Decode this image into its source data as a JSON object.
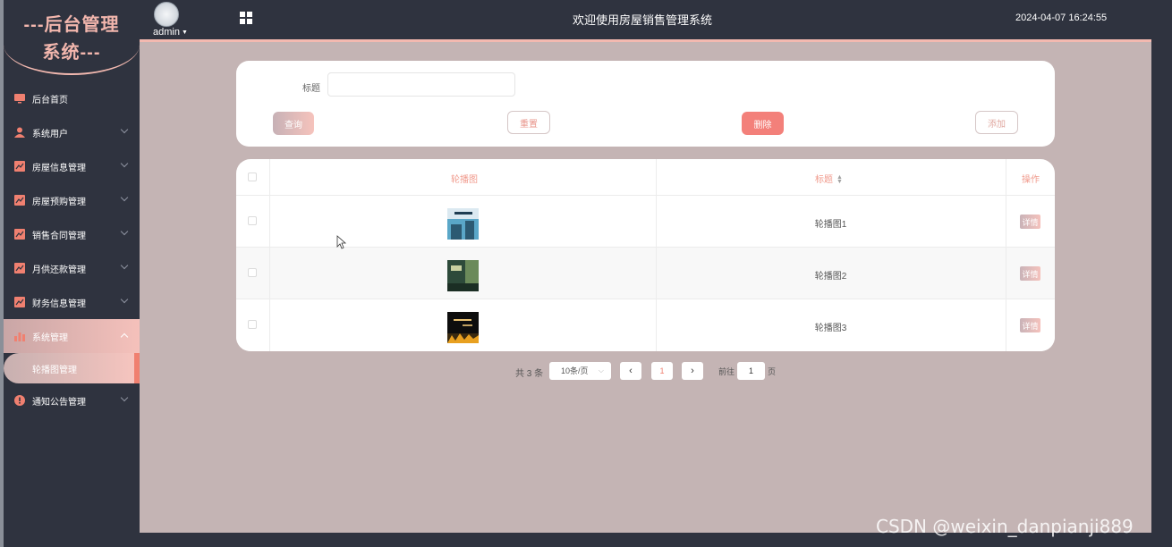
{
  "logo": {
    "line1": "---后台管理",
    "line2": "系统---"
  },
  "sidebar": {
    "items": [
      {
        "label": "后台首页",
        "icon": "monitor-icon",
        "has_children": false
      },
      {
        "label": "系统用户",
        "icon": "user-icon",
        "has_children": true
      },
      {
        "label": "房屋信息管理",
        "icon": "chart-line-icon",
        "has_children": true
      },
      {
        "label": "房屋预购管理",
        "icon": "chart-line-icon",
        "has_children": true
      },
      {
        "label": "销售合同管理",
        "icon": "chart-line-icon",
        "has_children": true
      },
      {
        "label": "月供还款管理",
        "icon": "chart-line-icon",
        "has_children": true
      },
      {
        "label": "财务信息管理",
        "icon": "chart-line-icon",
        "has_children": true
      },
      {
        "label": "系统管理",
        "icon": "bar-chart-icon",
        "has_children": true,
        "expanded": true
      },
      {
        "label": "通知公告管理",
        "icon": "info-icon",
        "has_children": true
      }
    ],
    "active_sub_item": "轮播图管理"
  },
  "header": {
    "user": "admin",
    "title": "欢迎使用房屋销售管理系统",
    "datetime": "2024-04-07 16:24:55"
  },
  "search": {
    "label": "标题",
    "value": "",
    "placeholder": "",
    "buttons": {
      "query": "查询",
      "reset": "重置",
      "delete": "删除",
      "add": "添加"
    }
  },
  "table": {
    "headers": {
      "image": "轮播图",
      "title": "标题",
      "action": "操作"
    },
    "rows": [
      {
        "title": "轮播图1",
        "action": "详情",
        "thumb_colors": [
          "#5aa7c8",
          "#dbe9f1",
          "#2c5a72"
        ]
      },
      {
        "title": "轮播图2",
        "action": "详情",
        "thumb_colors": [
          "#2d4a3a",
          "#6b8a5a",
          "#c8d0a0"
        ]
      },
      {
        "title": "轮播图3",
        "action": "详情",
        "thumb_colors": [
          "#0d0d0d",
          "#3a2a10",
          "#e8a020"
        ]
      }
    ]
  },
  "pagination": {
    "total": "共 3 条",
    "page_size": "10条/页",
    "current_page": "1",
    "goto_label": "前往",
    "goto_value": "1",
    "goto_unit": "页"
  },
  "watermark": "CSDN @weixin_danpianji889",
  "colors": {
    "accent": "#f3807a",
    "accent_light": "#f5c1bb",
    "sidebar_bg": "#2f333f",
    "main_bg": "#c4b4b4"
  }
}
